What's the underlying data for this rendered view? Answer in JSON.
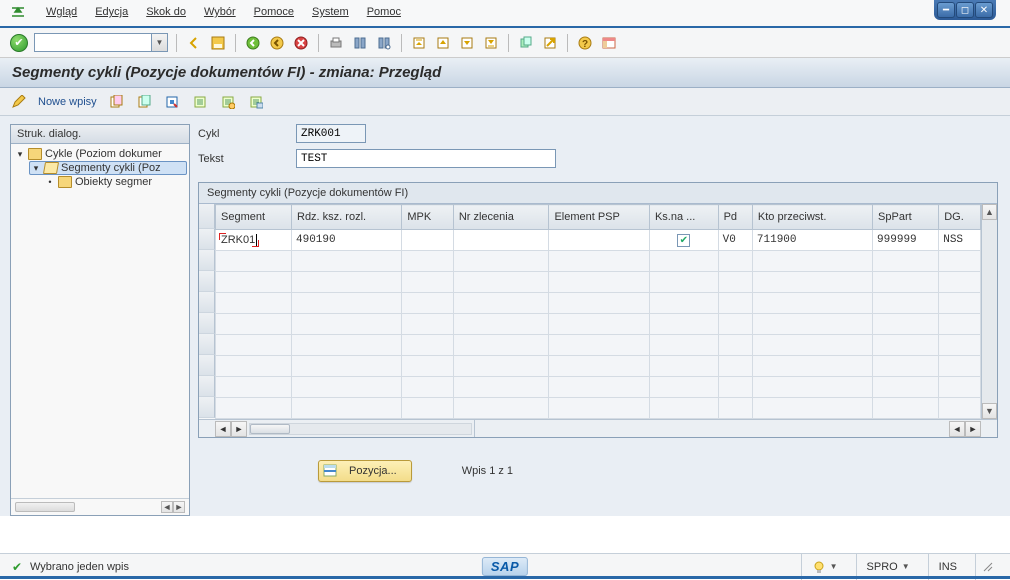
{
  "menu": [
    "Wgląd",
    "Edycja",
    "Skok do",
    "Wybór",
    "Pomoce",
    "System",
    "Pomoc"
  ],
  "title": "Segmenty cykli (Pozycje dokumentów FI) - zmiana: Przegląd",
  "subtoolbar": {
    "nowe_wpisy": "Nowe wpisy"
  },
  "tree": {
    "title": "Struk. dialog.",
    "nodes": {
      "root": "Cykle (Poziom dokumer",
      "seg": "Segmenty cykli (Poz",
      "obj": "Obiekty segmer"
    }
  },
  "form": {
    "cykl_label": "Cykl",
    "cykl_value": "ZRK001",
    "tekst_label": "Tekst",
    "tekst_value": "TEST"
  },
  "grid": {
    "title": "Segmenty cykli (Pozycje dokumentów FI)",
    "cols": [
      "Segment",
      "Rdz. ksz. rozl.",
      "MPK",
      "Nr zlecenia",
      "Element PSP",
      "Ks.na ...",
      "Pd",
      "Kto przeciwst.",
      "SpPart",
      "DG."
    ],
    "row": {
      "segment": "ZRK01",
      "rdz": "490190",
      "mpk": "",
      "nr_zlecenia": "",
      "element_psp": "",
      "ksna_checked": true,
      "pd": "V0",
      "kto": "711900",
      "sppart": "999999",
      "dg": "NSS"
    }
  },
  "pozycja_btn": "Pozycja...",
  "wpis_text": "Wpis 1 z 1",
  "status": {
    "msg": "Wybrano jeden wpis",
    "spro": "SPRO",
    "ins": "INS"
  }
}
